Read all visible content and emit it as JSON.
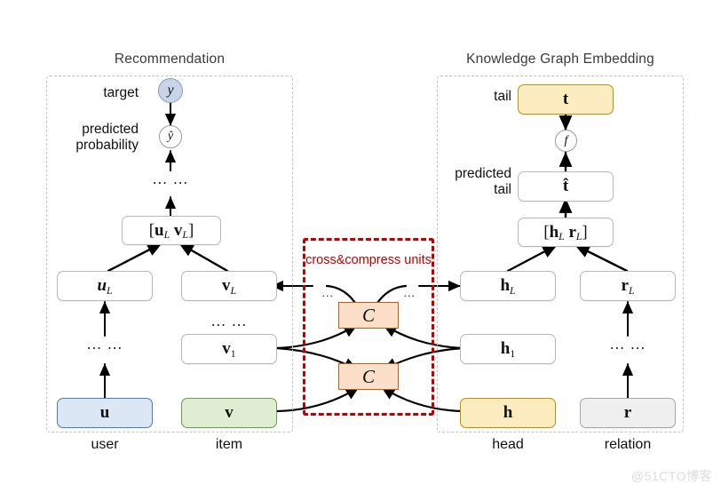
{
  "diagram": {
    "title_left": "Recommendation",
    "title_right": "Knowledge Graph Embedding",
    "center_label": "cross&compress units",
    "watermark": "@51CTO博客"
  },
  "labels": {
    "target": "target",
    "predicted_probability": "predicted\nprobability",
    "tail": "tail",
    "predicted_tail": "predicted\ntail",
    "predicted_probability_line1": "predicted",
    "predicted_probability_line2": "probability",
    "predicted_tail_line1": "predicted",
    "predicted_tail_line2": "tail"
  },
  "captions": {
    "user": "user",
    "item": "item",
    "head": "head",
    "relation": "relation"
  },
  "nodes": {
    "y": "y",
    "y_hat": "ŷ",
    "f": "f",
    "t": "t",
    "t_hat": "t̂",
    "concat_rec": "[u_L v_L]",
    "concat_kg": "[h_L r_L]",
    "u_L": "u_L",
    "v_L": "v_L",
    "h_L": "h_L",
    "r_L": "r_L",
    "v_1": "v_1",
    "h_1": "h_1",
    "u": "u",
    "v": "v",
    "h": "h",
    "r": "r",
    "cc_unit_top": "C",
    "cc_unit_bottom": "C"
  },
  "ellipses": {
    "rec_top": "… …",
    "user_col": "… …",
    "item_col": "… …",
    "relation_col": "… …",
    "cc_left": "…",
    "cc_right": "…"
  },
  "colors": {
    "user_fill": "#dce7f5",
    "user_border": "#4a7ebb",
    "item_fill": "#dfeed3",
    "item_border": "#6f9a4c",
    "head_fill": "#fdecbf",
    "head_border": "#bf9000",
    "relation_fill": "#efefef",
    "relation_border": "#a6a6a6",
    "cc_fill": "#fbdfc9",
    "cc_border": "#c55a11",
    "cc_dashed": "#c00000",
    "target_fill": "#c9d5e6",
    "group_dashed": "#c2c2c2",
    "arrow": "#000000"
  }
}
